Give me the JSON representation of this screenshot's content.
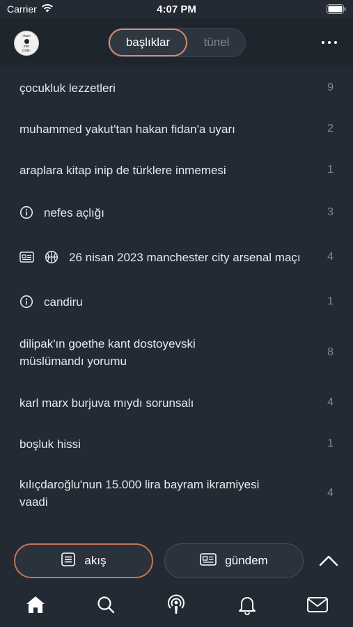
{
  "status": {
    "carrier": "Carrier",
    "time": "4:07 PM"
  },
  "header": {
    "avatar_text": [
      "i turn",
      "into",
      "code."
    ],
    "tabs": [
      {
        "label": "başlıklar",
        "active": true
      },
      {
        "label": "tünel",
        "active": false
      }
    ],
    "accent_color": "#d98970"
  },
  "topics": [
    {
      "title": "çocukluk lezzetleri",
      "count": "9",
      "icons": []
    },
    {
      "title": "muhammed yakut'tan hakan fidan'a uyarı",
      "count": "2",
      "icons": []
    },
    {
      "title": "araplara kitap inip de türklere inmemesi",
      "count": "1",
      "icons": []
    },
    {
      "title": "nefes açlığı",
      "count": "3",
      "icons": [
        "info-icon"
      ]
    },
    {
      "title": "26 nisan 2023 manchester city arsenal maçı",
      "count": "4",
      "icons": [
        "newspaper-icon",
        "basketball-icon"
      ]
    },
    {
      "title": "candiru",
      "count": "1",
      "icons": [
        "info-icon"
      ]
    },
    {
      "title_lines": [
        "dilipak'ın goethe kant dostoyevski",
        "müslümandı yorumu"
      ],
      "count": "8",
      "icons": []
    },
    {
      "title": "karl marx burjuva mıydı sorunsalı",
      "count": "4",
      "icons": []
    },
    {
      "title": "boşluk hissi",
      "count": "1",
      "icons": []
    },
    {
      "title_lines": [
        "kılıçdaroğlu'nun 15.000 lira bayram ikramiyesi",
        "vaadi"
      ],
      "count": "4",
      "icons": []
    }
  ],
  "bottom": {
    "akis_label": "akış",
    "gundem_label": "gündem"
  },
  "tabbar": [
    "home-icon",
    "search-icon",
    "podcast-icon",
    "bell-icon",
    "mail-icon"
  ]
}
